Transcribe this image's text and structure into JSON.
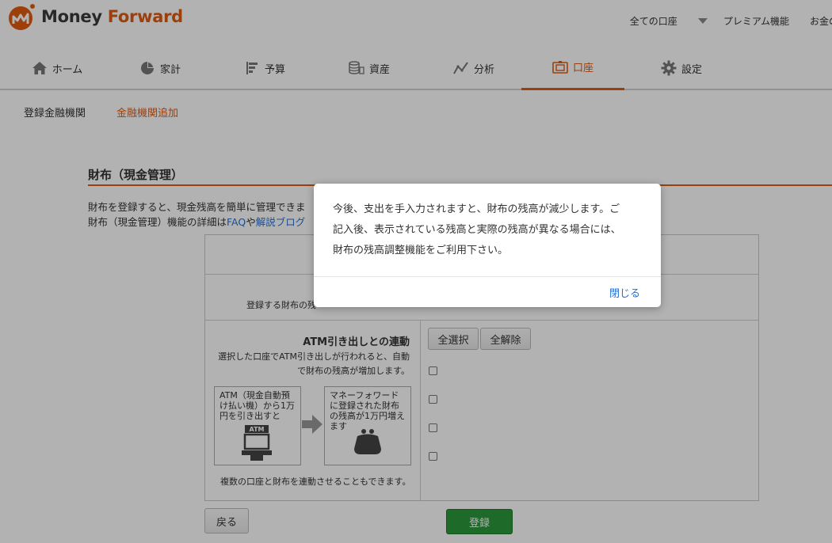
{
  "brand": {
    "word1": "Money",
    "word2": "Forward"
  },
  "header_links": [
    "全ての口座",
    "プレミアム機能",
    "お金の"
  ],
  "nav": [
    {
      "label": "ホーム",
      "icon": "home-icon"
    },
    {
      "label": "家計",
      "icon": "pie-chart-icon"
    },
    {
      "label": "予算",
      "icon": "budget-icon"
    },
    {
      "label": "資産",
      "icon": "assets-icon"
    },
    {
      "label": "分析",
      "icon": "line-chart-icon"
    },
    {
      "label": "口座",
      "icon": "account-icon",
      "active": true
    },
    {
      "label": "設定",
      "icon": "gear-icon"
    }
  ],
  "subnav": [
    {
      "label": "登録金融機関"
    },
    {
      "label": "金融機関追加",
      "active": true
    }
  ],
  "section": {
    "title": "財布（現金管理）",
    "desc_line1": "財布を登録すると、現金残高を簡単に管理できま",
    "desc_line2_prefix": "財布（現金管理）機能の詳細は",
    "faq_link": "FAQ",
    "desc_line2_mid": "や",
    "blog_link": "解説ブログ"
  },
  "panel": {
    "register_label": "登録する財布の残",
    "atm_title": "ATM引き出しとの連動",
    "atm_desc_line1": "選択した口座でATM引き出しが行われると、自動",
    "atm_desc_line2": "で財布の残高が増加します。",
    "box1_text": "ATM（現金自動預け払い機）から1万円を引き出すと",
    "atm_label": "ATM",
    "box2_text": "マネーフォワードに登録された財布の残高が1万円増えます",
    "multi_note": "複数の口座と財布を連動させることもできます。",
    "select_all": "全選択",
    "clear_all": "全解除"
  },
  "buttons": {
    "back": "戻る",
    "register": "登録"
  },
  "dialog": {
    "line1": "今後、支出を手入力されますと、財布の残高が減少します。ご",
    "line2": "記入後、表示されている残高と実際の残高が異なる場合には、",
    "line3": "財布の残高調整機能をご利用下さい。",
    "close": "閉じる"
  },
  "colors": {
    "accent": "#e05b11",
    "link": "#2a6fcf",
    "primary_button": "#2c9a3b"
  }
}
